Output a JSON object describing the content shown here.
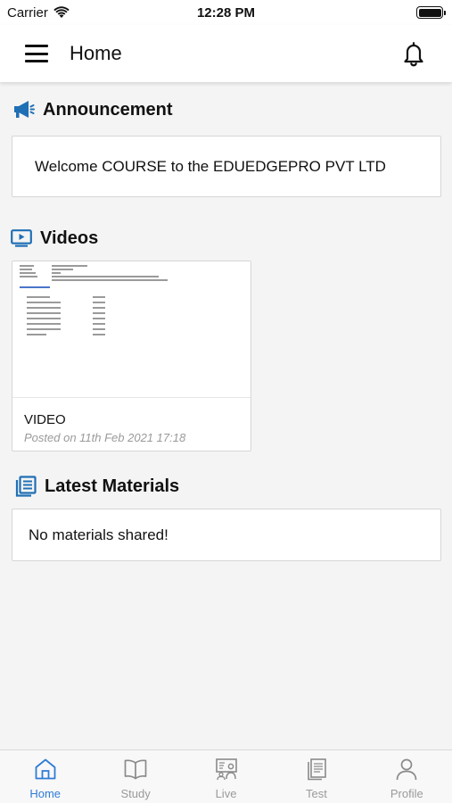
{
  "status_bar": {
    "carrier": "Carrier",
    "time": "12:28 PM"
  },
  "header": {
    "title": "Home",
    "menu_icon": "hamburger-menu-icon",
    "bell_icon": "bell-icon"
  },
  "announcement": {
    "title": "Announcement",
    "icon": "megaphone-icon",
    "message": "Welcome COURSE to the EDUEDGEPRO PVT LTD"
  },
  "videos": {
    "title": "Videos",
    "icon": "video-player-icon",
    "items": [
      {
        "title": "VIDEO",
        "posted": "Posted on 11th Feb 2021 17:18"
      }
    ]
  },
  "materials": {
    "title": "Latest Materials",
    "icon": "materials-book-icon",
    "empty_message": "No materials shared!"
  },
  "tab_bar": {
    "tabs": [
      {
        "label": "Home",
        "icon": "home-icon",
        "active": true
      },
      {
        "label": "Study",
        "icon": "book-icon",
        "active": false
      },
      {
        "label": "Live",
        "icon": "live-class-icon",
        "active": false
      },
      {
        "label": "Test",
        "icon": "test-documents-icon",
        "active": false
      },
      {
        "label": "Profile",
        "icon": "profile-icon",
        "active": false
      }
    ]
  },
  "colors": {
    "accent": "#2e7bd6",
    "inactive": "#9a9a9a",
    "icon_blue": "#1f6fb5"
  }
}
